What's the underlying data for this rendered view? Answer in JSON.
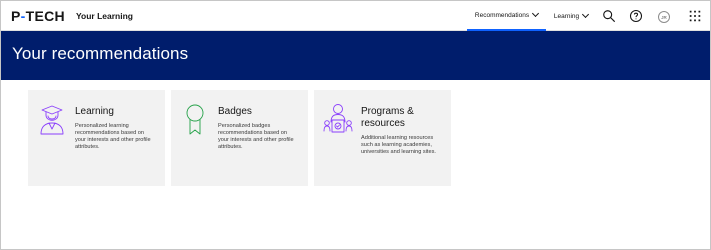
{
  "brand": {
    "logo_left": "P",
    "logo_dash": "-",
    "logo_right": "TECH",
    "app_name": "Your Learning"
  },
  "nav": {
    "recommendations_label": "Recommendations",
    "learning_label": "Learning",
    "avatar_initials": "JR"
  },
  "icons": {
    "search": "search-icon",
    "help": "help-icon",
    "apps": "app-switcher-icon"
  },
  "colors": {
    "banner": "#001d6c",
    "accent": "#0f62fe",
    "tile_bg": "#f2f2f2",
    "icon_stroke": "#8a3ffc"
  },
  "banner": {
    "title": "Your recommendations"
  },
  "tiles": [
    {
      "title": "Learning",
      "description": "Personalized learning recommendations based on your interests and other profile attributes.",
      "icon": "learner-icon"
    },
    {
      "title": "Badges",
      "description": "Personalized badges recommendations based on your interests and other profile attributes.",
      "icon": "badge-icon"
    },
    {
      "title": "Programs & resources",
      "description": "Additional learning resources such as learning academies, universities and learning sites.",
      "icon": "programs-icon"
    }
  ]
}
